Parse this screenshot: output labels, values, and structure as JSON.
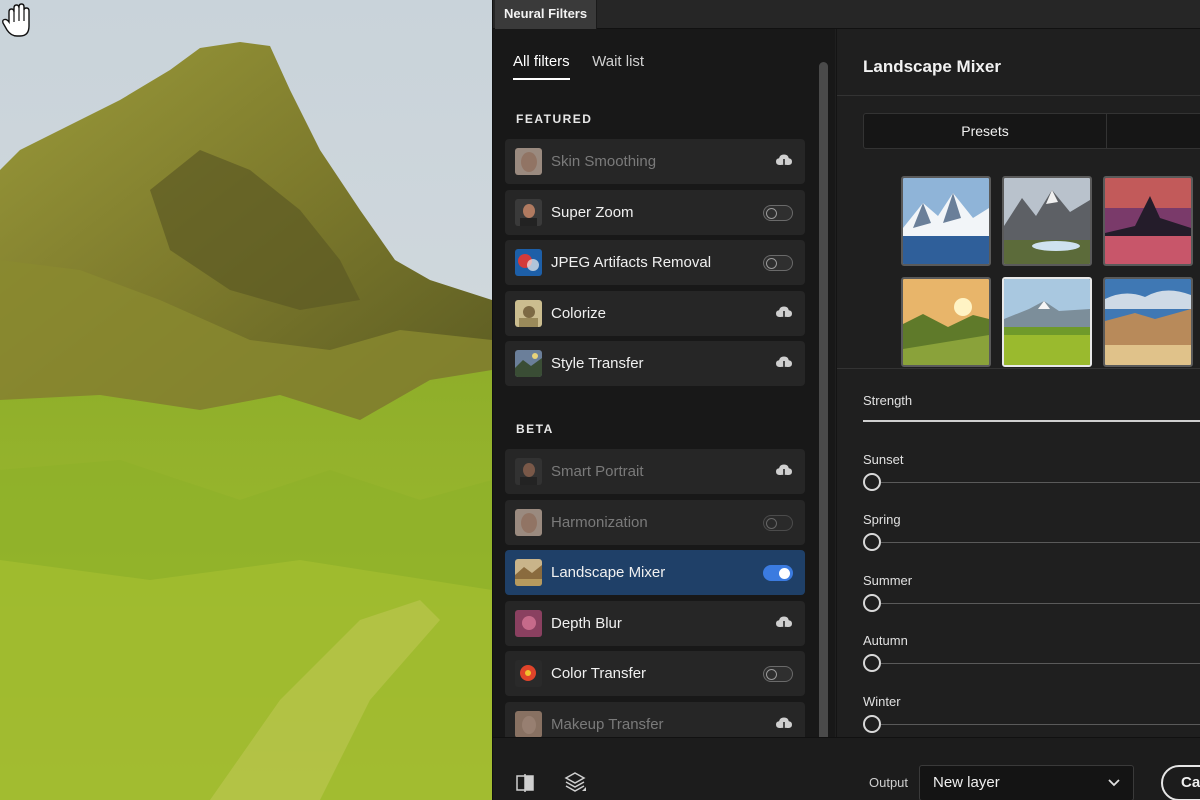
{
  "window": {
    "tab_title": "Neural Filters"
  },
  "list_tabs": [
    {
      "label": "All filters",
      "active": true
    },
    {
      "label": "Wait list",
      "active": false
    }
  ],
  "sections": {
    "featured": {
      "title": "FEATURED",
      "items": [
        {
          "label": "Skin Smoothing",
          "control": "cloud",
          "dim": true,
          "icon": "face-thumb-icon"
        },
        {
          "label": "Super Zoom",
          "control": "toggle",
          "on": false,
          "icon": "portrait-thumb-icon"
        },
        {
          "label": "JPEG Artifacts Removal",
          "control": "toggle",
          "on": false,
          "icon": "abstract-thumb-icon"
        },
        {
          "label": "Colorize",
          "control": "cloud",
          "icon": "vintage-thumb-icon"
        },
        {
          "label": "Style Transfer",
          "control": "cloud",
          "icon": "painting-thumb-icon"
        }
      ]
    },
    "beta": {
      "title": "BETA",
      "items": [
        {
          "label": "Smart Portrait",
          "control": "cloud",
          "dim": true,
          "icon": "portrait-thumb-icon"
        },
        {
          "label": "Harmonization",
          "control": "toggle",
          "on": false,
          "dim": true,
          "icon": "face-thumb-icon"
        },
        {
          "label": "Landscape Mixer",
          "control": "toggle",
          "on": true,
          "selected": true,
          "icon": "landscape-thumb-icon"
        },
        {
          "label": "Depth Blur",
          "control": "cloud",
          "icon": "blur-thumb-icon"
        },
        {
          "label": "Color Transfer",
          "control": "toggle",
          "on": false,
          "icon": "flower-thumb-icon"
        },
        {
          "label": "Makeup Transfer",
          "control": "cloud",
          "dim": true,
          "icon": "makeup-thumb-icon"
        }
      ]
    }
  },
  "detail": {
    "title": "Landscape Mixer",
    "presets_tab": "Presets",
    "presets": [
      {
        "name": "snowy-lake-preset",
        "selected": false
      },
      {
        "name": "mountain-valley-preset",
        "selected": false
      },
      {
        "name": "sunset-peak-preset",
        "selected": false
      },
      {
        "name": "golden-hills-preset",
        "selected": false
      },
      {
        "name": "green-meadow-preset",
        "selected": true
      },
      {
        "name": "desert-cliffs-preset",
        "selected": false
      }
    ],
    "strength_label": "Strength",
    "sliders": [
      {
        "label": "Sunset",
        "value": 0
      },
      {
        "label": "Spring",
        "value": 0
      },
      {
        "label": "Summer",
        "value": 0
      },
      {
        "label": "Autumn",
        "value": 0
      },
      {
        "label": "Winter",
        "value": 0
      }
    ]
  },
  "bottom": {
    "output_label": "Output",
    "output_value": "New layer",
    "cancel_label": "Cancel"
  },
  "colors": {
    "accent": "#3b7be0",
    "selected_row": "#1f4068",
    "panel_bg": "#1f1f1f"
  }
}
